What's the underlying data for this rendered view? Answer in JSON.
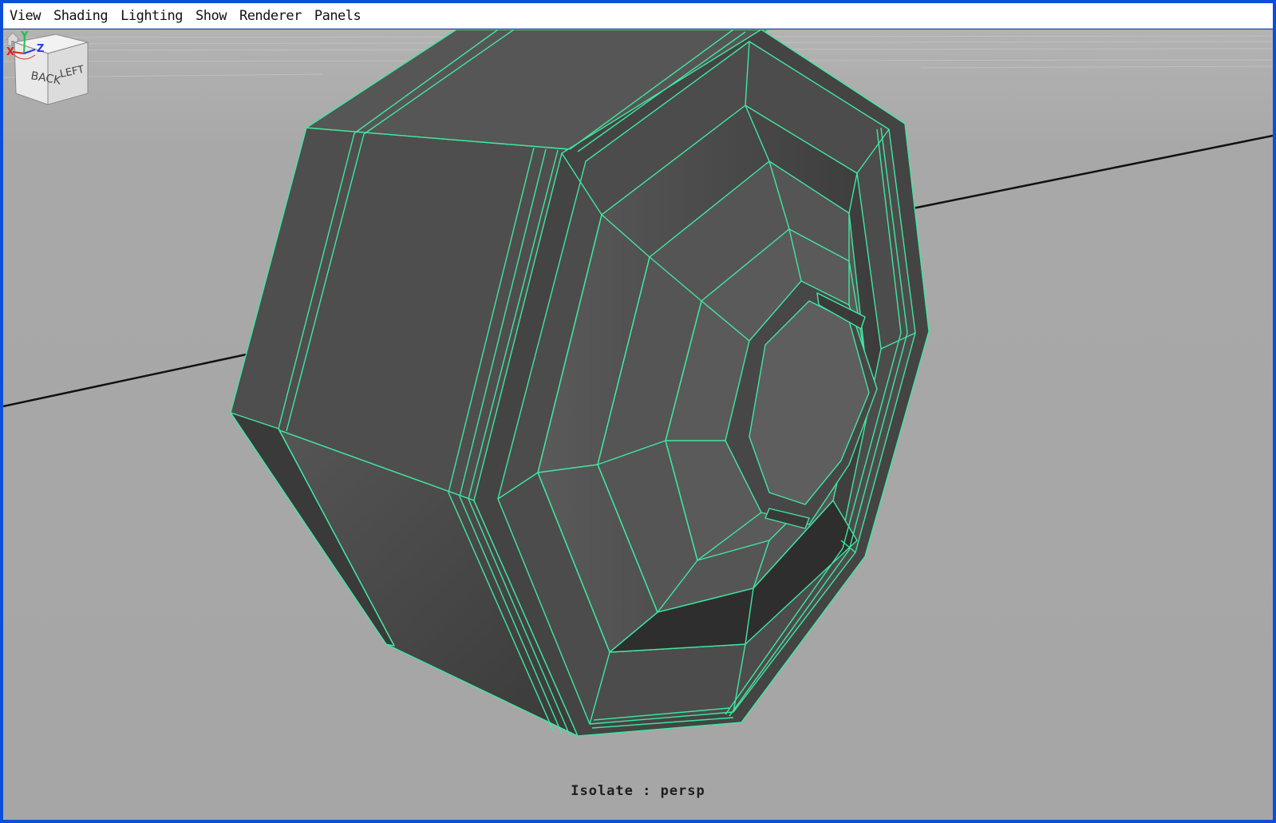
{
  "menubar": {
    "items": [
      {
        "label": "View"
      },
      {
        "label": "Shading"
      },
      {
        "label": "Lighting"
      },
      {
        "label": "Show"
      },
      {
        "label": "Renderer"
      },
      {
        "label": "Panels"
      }
    ]
  },
  "viewport": {
    "hud_label": "Isolate : persp",
    "viewcube": {
      "face_back": "BACK",
      "face_left": "LEFT"
    },
    "axis_gizmo": {
      "x_label": "X",
      "y_label": "Y",
      "z_label": "Z",
      "x_color": "#e0201c",
      "y_color": "#1ec24a",
      "z_color": "#2a3cf0"
    },
    "wireframe_color": "#3fe8a0",
    "background_color": "#a6a6a6",
    "mesh_color": "#4a4a4a"
  },
  "icons": {
    "home": "home-icon",
    "viewcube": "viewcube-icon",
    "axis": "axis-gizmo-icon"
  }
}
